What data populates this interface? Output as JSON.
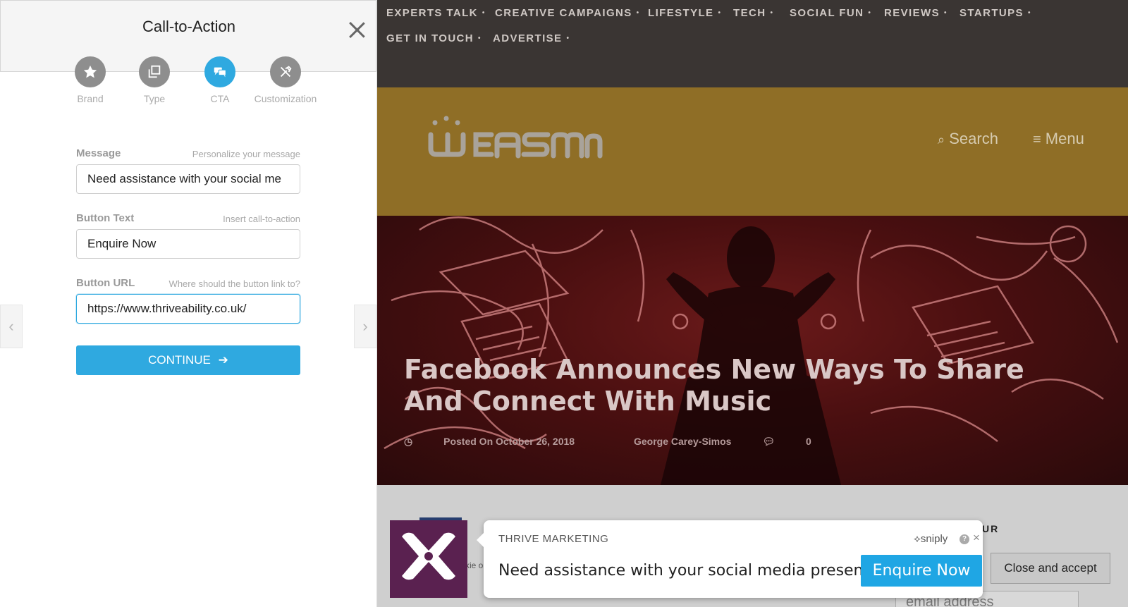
{
  "editor": {
    "title": "Call-to-Action",
    "steps": [
      {
        "label": "Brand",
        "icon": "star-icon"
      },
      {
        "label": "Type",
        "icon": "copy-icon"
      },
      {
        "label": "CTA",
        "icon": "chat-icon",
        "active": true
      },
      {
        "label": "Customization",
        "icon": "tools-icon"
      }
    ],
    "fields": {
      "message": {
        "label": "Message",
        "hint": "Personalize your message",
        "value": "Need assistance with your social me"
      },
      "button_text": {
        "label": "Button Text",
        "hint": "Insert call-to-action",
        "value": "Enquire Now"
      },
      "button_url": {
        "label": "Button URL",
        "hint": "Where should the button link to?",
        "value": "https://www.thriveability.co.uk/"
      }
    },
    "continue_label": "CONTINUE",
    "accent": "#2fa9e0"
  },
  "site": {
    "nav": [
      "EXPERTS TALK",
      "CREATIVE CAMPAIGNS",
      "LIFESTYLE",
      "TECH",
      "SOCIAL FUN",
      "REVIEWS",
      "STARTUPS",
      "GET IN TOUCH",
      "ADVERTISE"
    ],
    "nav_dot": "•",
    "search_label": "Search",
    "menu_label": "Menu",
    "headline": "Facebook Announces New Ways To Share And Connect With Music",
    "meta": {
      "posted": "Posted On October 26, 2018",
      "author": "George Carey-Simos",
      "comments": "0"
    },
    "sidebar_heading_partial": "UR",
    "cookie_button": "Close and accept",
    "email_placeholder": "email address",
    "partial_text": "kie\nore,"
  },
  "sniply": {
    "company": "THRIVE MARKETING",
    "brand": "sniply",
    "message": "Need assistance with your social media presence?",
    "button": "Enquire Now",
    "help": "?",
    "close": "×",
    "logo_bg": "#5a2150",
    "button_color": "#1fa6e4"
  }
}
